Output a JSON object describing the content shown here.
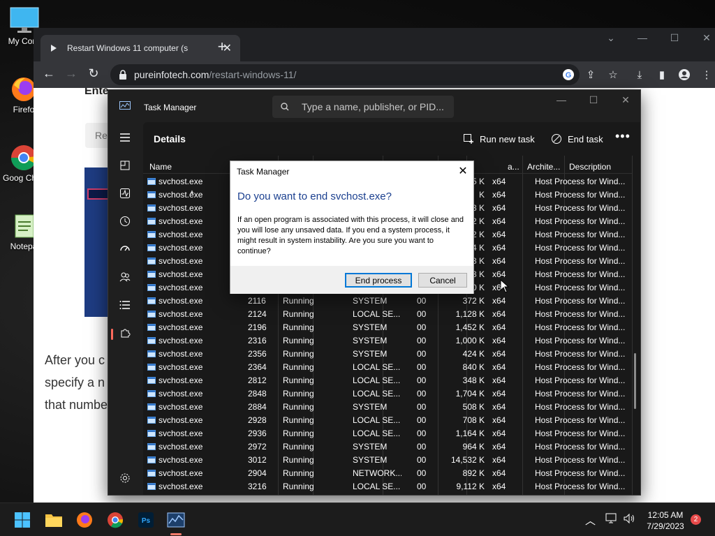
{
  "desktop": {
    "icons": [
      {
        "label": "My Com",
        "icon": "monitor-icon"
      },
      {
        "label": "Firefo",
        "icon": "firefox-icon"
      },
      {
        "label": "Goog Chron",
        "icon": "chrome-icon"
      },
      {
        "label": "Notepa",
        "icon": "notepad-icon"
      }
    ]
  },
  "browser": {
    "tab_title": "Restart Windows 11 computer (s",
    "url_domain": "pureinfotech.com",
    "url_path": "/restart-windows-11/",
    "page": {
      "heading_partial": "Ente",
      "box_partial": "Re",
      "para": [
        "After you c",
        "specify a n",
        "that numbe"
      ]
    }
  },
  "task_manager": {
    "title": "Task Manager",
    "search_placeholder": "Type a name, publisher, or PID...",
    "section": "Details",
    "run_new_task": "Run new task",
    "end_task": "End task",
    "columns": {
      "name": "Name",
      "memory_partial": "a...",
      "arch": "Archite...",
      "description": "Description"
    },
    "rows": [
      {
        "name": "svchost.exe",
        "pid": "",
        "status": "",
        "user": "",
        "cpu": "",
        "mem": "5 K",
        "arch": "x64",
        "desc": "Host Process for Wind..."
      },
      {
        "name": "svchost.exe",
        "pid": "",
        "status": "",
        "user": "",
        "cpu": "",
        "mem": "K",
        "arch": "x64",
        "desc": "Host Process for Wind..."
      },
      {
        "name": "svchost.exe",
        "pid": "",
        "status": "",
        "user": "",
        "cpu": "",
        "mem": "3 K",
        "arch": "x64",
        "desc": "Host Process for Wind..."
      },
      {
        "name": "svchost.exe",
        "pid": "",
        "status": "",
        "user": "",
        "cpu": "",
        "mem": "2 K",
        "arch": "x64",
        "desc": "Host Process for Wind..."
      },
      {
        "name": "svchost.exe",
        "pid": "",
        "status": "",
        "user": "",
        "cpu": "",
        "mem": "2 K",
        "arch": "x64",
        "desc": "Host Process for Wind..."
      },
      {
        "name": "svchost.exe",
        "pid": "",
        "status": "",
        "user": "",
        "cpu": "",
        "mem": "4 K",
        "arch": "x64",
        "desc": "Host Process for Wind..."
      },
      {
        "name": "svchost.exe",
        "pid": "",
        "status": "",
        "user": "",
        "cpu": "",
        "mem": "3 K",
        "arch": "x64",
        "desc": "Host Process for Wind..."
      },
      {
        "name": "svchost.exe",
        "pid": "",
        "status": "",
        "user": "",
        "cpu": "",
        "mem": "3 K",
        "arch": "x64",
        "desc": "Host Process for Wind..."
      },
      {
        "name": "svchost.exe",
        "pid": "",
        "status": "",
        "user": "",
        "cpu": "",
        "mem": "0 K",
        "arch": "x6",
        "desc": "Host Process for Wind..."
      },
      {
        "name": "svchost.exe",
        "pid": "2116",
        "status": "Running",
        "user": "SYSTEM",
        "cpu": "00",
        "mem": "372 K",
        "arch": "x64",
        "desc": "Host Process for Wind..."
      },
      {
        "name": "svchost.exe",
        "pid": "2124",
        "status": "Running",
        "user": "LOCAL SE...",
        "cpu": "00",
        "mem": "1,128 K",
        "arch": "x64",
        "desc": "Host Process for Wind..."
      },
      {
        "name": "svchost.exe",
        "pid": "2196",
        "status": "Running",
        "user": "SYSTEM",
        "cpu": "00",
        "mem": "1,452 K",
        "arch": "x64",
        "desc": "Host Process for Wind..."
      },
      {
        "name": "svchost.exe",
        "pid": "2316",
        "status": "Running",
        "user": "SYSTEM",
        "cpu": "00",
        "mem": "1,000 K",
        "arch": "x64",
        "desc": "Host Process for Wind..."
      },
      {
        "name": "svchost.exe",
        "pid": "2356",
        "status": "Running",
        "user": "SYSTEM",
        "cpu": "00",
        "mem": "424 K",
        "arch": "x64",
        "desc": "Host Process for Wind..."
      },
      {
        "name": "svchost.exe",
        "pid": "2364",
        "status": "Running",
        "user": "LOCAL SE...",
        "cpu": "00",
        "mem": "840 K",
        "arch": "x64",
        "desc": "Host Process for Wind..."
      },
      {
        "name": "svchost.exe",
        "pid": "2812",
        "status": "Running",
        "user": "LOCAL SE...",
        "cpu": "00",
        "mem": "348 K",
        "arch": "x64",
        "desc": "Host Process for Wind..."
      },
      {
        "name": "svchost.exe",
        "pid": "2848",
        "status": "Running",
        "user": "LOCAL SE...",
        "cpu": "00",
        "mem": "1,704 K",
        "arch": "x64",
        "desc": "Host Process for Wind..."
      },
      {
        "name": "svchost.exe",
        "pid": "2884",
        "status": "Running",
        "user": "SYSTEM",
        "cpu": "00",
        "mem": "508 K",
        "arch": "x64",
        "desc": "Host Process for Wind..."
      },
      {
        "name": "svchost.exe",
        "pid": "2928",
        "status": "Running",
        "user": "LOCAL SE...",
        "cpu": "00",
        "mem": "708 K",
        "arch": "x64",
        "desc": "Host Process for Wind..."
      },
      {
        "name": "svchost.exe",
        "pid": "2936",
        "status": "Running",
        "user": "LOCAL SE...",
        "cpu": "00",
        "mem": "1,164 K",
        "arch": "x64",
        "desc": "Host Process for Wind..."
      },
      {
        "name": "svchost.exe",
        "pid": "2972",
        "status": "Running",
        "user": "SYSTEM",
        "cpu": "00",
        "mem": "964 K",
        "arch": "x64",
        "desc": "Host Process for Wind..."
      },
      {
        "name": "svchost.exe",
        "pid": "3012",
        "status": "Running",
        "user": "SYSTEM",
        "cpu": "00",
        "mem": "14,532 K",
        "arch": "x64",
        "desc": "Host Process for Wind..."
      },
      {
        "name": "svchost.exe",
        "pid": "2904",
        "status": "Running",
        "user": "NETWORK...",
        "cpu": "00",
        "mem": "892 K",
        "arch": "x64",
        "desc": "Host Process for Wind..."
      },
      {
        "name": "svchost.exe",
        "pid": "3216",
        "status": "Running",
        "user": "LOCAL SE...",
        "cpu": "00",
        "mem": "9,112 K",
        "arch": "x64",
        "desc": "Host Process for Wind..."
      }
    ]
  },
  "dialog": {
    "title": "Task Manager",
    "question": "Do you want to end svchost.exe?",
    "message": "If an open program is associated with this process, it will close and you will lose any unsaved data. If you end a system process, it might result in system instability. Are you sure you want to continue?",
    "primary": "End process",
    "secondary": "Cancel"
  },
  "taskbar": {
    "time": "12:05 AM",
    "date": "7/29/2023",
    "notifications": "2"
  },
  "colors": {
    "accent": "#0078d7",
    "tm_selection": "#ff6a5c",
    "dialog_heading": "#1a3f8f"
  }
}
